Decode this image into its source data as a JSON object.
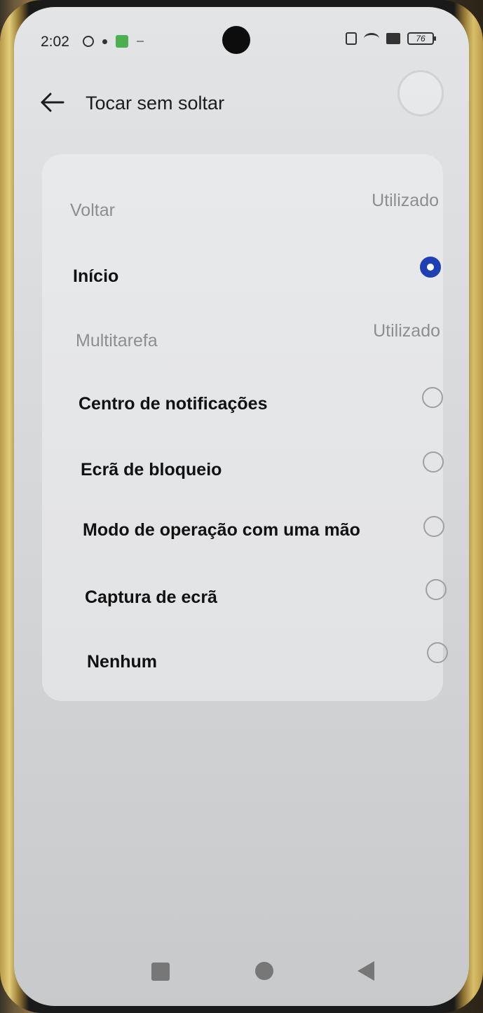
{
  "status_bar": {
    "time": "2:02",
    "battery": "76",
    "icons_left": [
      "gear-icon",
      "dot-icon",
      "app-notification-icon",
      "dash-icon"
    ],
    "icons_right": [
      "nfc-icon",
      "wifi-icon",
      "sim-icon",
      "battery-icon"
    ]
  },
  "header": {
    "title": "Tocar sem soltar",
    "back_icon": "arrow-left-icon"
  },
  "options": [
    {
      "label": "Voltar",
      "status": "Utilizado",
      "disabled": true
    },
    {
      "label": "Início",
      "selected": true
    },
    {
      "label": "Multitarefa",
      "status": "Utilizado",
      "disabled": true
    },
    {
      "label": "Centro de notificações",
      "selected": false
    },
    {
      "label": "Ecrã de bloqueio",
      "selected": false
    },
    {
      "label": "Modo de operação com uma mão",
      "selected": false
    },
    {
      "label": "Captura de ecrã",
      "selected": false
    },
    {
      "label": "Nenhum",
      "selected": false
    }
  ],
  "nav_bar": {
    "icons": [
      "recents-square-icon",
      "home-circle-icon",
      "back-triangle-icon"
    ]
  },
  "colors": {
    "accent": "#1f3fb5",
    "disabled_text": "#8c8e90",
    "background": "#d6d8da"
  }
}
